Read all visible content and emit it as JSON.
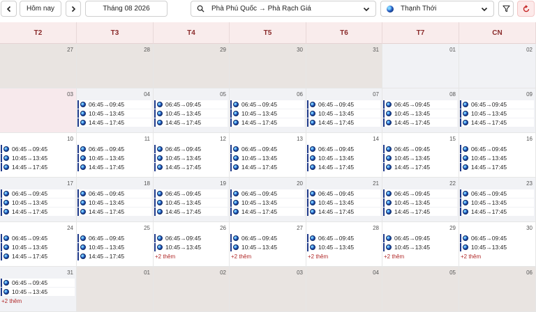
{
  "toolbar": {
    "today_label": "Hôm nay",
    "month_label": "Tháng 08 2026",
    "route_label": "Phà Phú Quốc → Phà Rạch Giá",
    "vessel_label": "Thạnh Thới",
    "icons": {
      "prev": "chevron-left-icon",
      "next": "chevron-right-icon",
      "search": "search-icon",
      "dropdown": "chevron-down-icon",
      "filter": "filter-icon",
      "refresh": "refresh-icon"
    },
    "accent_color": "#c62828"
  },
  "calendar": {
    "weekdays": [
      "T2",
      "T3",
      "T4",
      "T5",
      "T6",
      "T7",
      "CN"
    ],
    "weeks": [
      [
        {
          "day": "27",
          "type": "muted",
          "events": [],
          "more": ""
        },
        {
          "day": "28",
          "type": "muted",
          "events": [],
          "more": ""
        },
        {
          "day": "29",
          "type": "muted",
          "events": [],
          "more": ""
        },
        {
          "day": "30",
          "type": "muted",
          "events": [],
          "more": ""
        },
        {
          "day": "31",
          "type": "muted",
          "events": [],
          "more": ""
        },
        {
          "day": "01",
          "type": "future",
          "events": [],
          "more": ""
        },
        {
          "day": "02",
          "type": "future",
          "events": [],
          "more": ""
        }
      ],
      [
        {
          "day": "03",
          "type": "past",
          "events": [],
          "more": ""
        },
        {
          "day": "04",
          "type": "future",
          "events": [
            "06:45→09:45",
            "10:45→13:45",
            "14:45→17:45"
          ],
          "more": ""
        },
        {
          "day": "05",
          "type": "future",
          "events": [
            "06:45→09:45",
            "10:45→13:45",
            "14:45→17:45"
          ],
          "more": ""
        },
        {
          "day": "06",
          "type": "future",
          "events": [
            "06:45→09:45",
            "10:45→13:45",
            "14:45→17:45"
          ],
          "more": ""
        },
        {
          "day": "07",
          "type": "future",
          "events": [
            "06:45→09:45",
            "10:45→13:45",
            "14:45→17:45"
          ],
          "more": ""
        },
        {
          "day": "08",
          "type": "future",
          "events": [
            "06:45→09:45",
            "10:45→13:45",
            "14:45→17:45"
          ],
          "more": ""
        },
        {
          "day": "09",
          "type": "future",
          "events": [
            "06:45→09:45",
            "10:45→13:45",
            "14:45→17:45"
          ],
          "more": ""
        }
      ],
      [
        {
          "day": "10",
          "type": "outside",
          "events": [
            "06:45→09:45",
            "10:45→13:45",
            "14:45→17:45"
          ],
          "more": ""
        },
        {
          "day": "11",
          "type": "outside",
          "events": [
            "06:45→09:45",
            "10:45→13:45",
            "14:45→17:45"
          ],
          "more": ""
        },
        {
          "day": "12",
          "type": "outside",
          "events": [
            "06:45→09:45",
            "10:45→13:45",
            "14:45→17:45"
          ],
          "more": ""
        },
        {
          "day": "13",
          "type": "outside",
          "events": [
            "06:45→09:45",
            "10:45→13:45",
            "14:45→17:45"
          ],
          "more": ""
        },
        {
          "day": "14",
          "type": "outside",
          "events": [
            "06:45→09:45",
            "10:45→13:45",
            "14:45→17:45"
          ],
          "more": ""
        },
        {
          "day": "15",
          "type": "outside",
          "events": [
            "06:45→09:45",
            "10:45→13:45",
            "14:45→17:45"
          ],
          "more": ""
        },
        {
          "day": "16",
          "type": "outside",
          "events": [
            "06:45→09:45",
            "10:45→13:45",
            "14:45→17:45"
          ],
          "more": ""
        }
      ],
      [
        {
          "day": "17",
          "type": "future",
          "events": [
            "06:45→09:45",
            "10:45→13:45",
            "14:45→17:45"
          ],
          "more": ""
        },
        {
          "day": "18",
          "type": "future",
          "events": [
            "06:45→09:45",
            "10:45→13:45",
            "14:45→17:45"
          ],
          "more": ""
        },
        {
          "day": "19",
          "type": "future",
          "events": [
            "06:45→09:45",
            "10:45→13:45",
            "14:45→17:45"
          ],
          "more": ""
        },
        {
          "day": "20",
          "type": "future",
          "events": [
            "06:45→09:45",
            "10:45→13:45",
            "14:45→17:45"
          ],
          "more": ""
        },
        {
          "day": "21",
          "type": "future",
          "events": [
            "06:45→09:45",
            "10:45→13:45",
            "14:45→17:45"
          ],
          "more": ""
        },
        {
          "day": "22",
          "type": "future",
          "events": [
            "06:45→09:45",
            "10:45→13:45",
            "14:45→17:45"
          ],
          "more": ""
        },
        {
          "day": "23",
          "type": "future",
          "events": [
            "06:45→09:45",
            "10:45→13:45",
            "14:45→17:45"
          ],
          "more": ""
        }
      ],
      [
        {
          "day": "24",
          "type": "outside",
          "events": [
            "06:45→09:45",
            "10:45→13:45",
            "14:45→17:45"
          ],
          "more": ""
        },
        {
          "day": "25",
          "type": "outside",
          "events": [
            "06:45→09:45",
            "10:45→13:45",
            "14:45→17:45"
          ],
          "more": ""
        },
        {
          "day": "26",
          "type": "outside",
          "events": [
            "06:45→09:45",
            "10:45→13:45"
          ],
          "more": "+2 thêm"
        },
        {
          "day": "27",
          "type": "outside",
          "events": [
            "06:45→09:45",
            "10:45→13:45"
          ],
          "more": "+2 thêm"
        },
        {
          "day": "28",
          "type": "outside",
          "events": [
            "06:45→09:45",
            "10:45→13:45"
          ],
          "more": "+2 thêm"
        },
        {
          "day": "29",
          "type": "outside",
          "events": [
            "06:45→09:45",
            "10:45→13:45"
          ],
          "more": "+2 thêm"
        },
        {
          "day": "30",
          "type": "outside",
          "events": [
            "06:45→09:45",
            "10:45→13:45"
          ],
          "more": "+2 thêm"
        }
      ],
      [
        {
          "day": "31",
          "type": "future",
          "events": [
            "06:45→09:45",
            "10:45→13:45"
          ],
          "more": "+2 thêm"
        },
        {
          "day": "01",
          "type": "muted",
          "events": [],
          "more": ""
        },
        {
          "day": "02",
          "type": "muted",
          "events": [],
          "more": ""
        },
        {
          "day": "03",
          "type": "muted",
          "events": [],
          "more": ""
        },
        {
          "day": "04",
          "type": "muted",
          "events": [],
          "more": ""
        },
        {
          "day": "05",
          "type": "muted",
          "events": [],
          "more": ""
        },
        {
          "day": "06",
          "type": "muted",
          "events": [],
          "more": ""
        }
      ]
    ]
  }
}
